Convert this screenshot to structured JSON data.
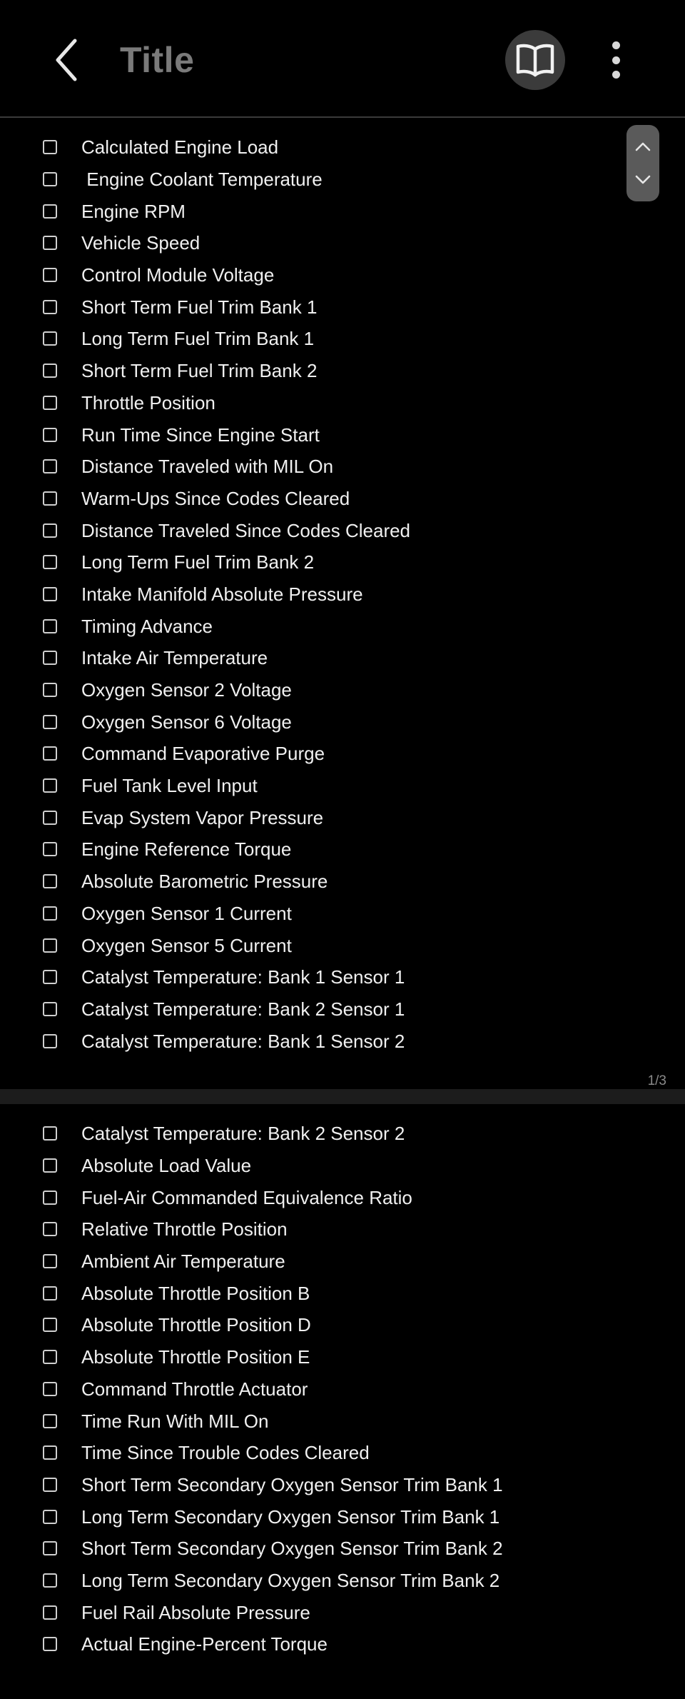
{
  "header": {
    "title": "Title"
  },
  "page1": {
    "items": [
      "Calculated Engine Load",
      " Engine Coolant Temperature",
      "Engine RPM",
      "Vehicle Speed",
      "Control Module Voltage",
      "Short Term Fuel Trim Bank 1",
      "Long Term Fuel Trim Bank 1",
      "Short Term Fuel Trim Bank 2",
      "Throttle Position",
      "Run Time Since Engine Start",
      "Distance Traveled with MIL On",
      "Warm-Ups Since Codes Cleared",
      "Distance Traveled Since Codes Cleared",
      "Long Term Fuel Trim Bank 2",
      "Intake Manifold Absolute Pressure",
      "Timing Advance",
      "Intake Air Temperature",
      "Oxygen Sensor 2 Voltage",
      "Oxygen Sensor 6 Voltage",
      "Command Evaporative Purge",
      "Fuel Tank Level Input",
      "Evap System Vapor Pressure",
      "Engine Reference Torque",
      "Absolute Barometric Pressure",
      "Oxygen Sensor 1 Current",
      "Oxygen Sensor 5 Current",
      "Catalyst Temperature: Bank 1 Sensor 1",
      "Catalyst Temperature: Bank 2 Sensor 1",
      "Catalyst Temperature: Bank 1 Sensor 2"
    ],
    "page_indicator": "1/3"
  },
  "page2": {
    "items": [
      "Catalyst Temperature: Bank 2 Sensor 2",
      "Absolute Load Value",
      "Fuel-Air Commanded Equivalence Ratio",
      "Relative Throttle Position",
      "Ambient Air Temperature",
      "Absolute Throttle Position B",
      "Absolute Throttle Position D",
      "Absolute Throttle Position E",
      "Command Throttle Actuator",
      "Time Run With MIL On",
      "Time Since Trouble Codes Cleared",
      "Short Term Secondary Oxygen Sensor Trim Bank 1",
      "Long Term Secondary Oxygen Sensor Trim Bank 1",
      "Short Term Secondary Oxygen Sensor Trim Bank 2",
      "Long Term Secondary Oxygen Sensor Trim Bank 2",
      "Fuel Rail Absolute Pressure",
      "Actual Engine-Percent Torque"
    ]
  },
  "icons": {
    "back": "chevron-left-icon",
    "reader": "book-open-icon",
    "more": "more-vertical-icon",
    "scroll_up": "chevron-up-icon",
    "scroll_down": "chevron-down-icon"
  },
  "colors": {
    "background": "#000000",
    "title": "#7a7a7a",
    "text": "#f0f0f0",
    "reader_button_bg": "#3b3b3b",
    "scroll_control_bg": "#5a5a5a",
    "separator": "#1c1c1c"
  }
}
